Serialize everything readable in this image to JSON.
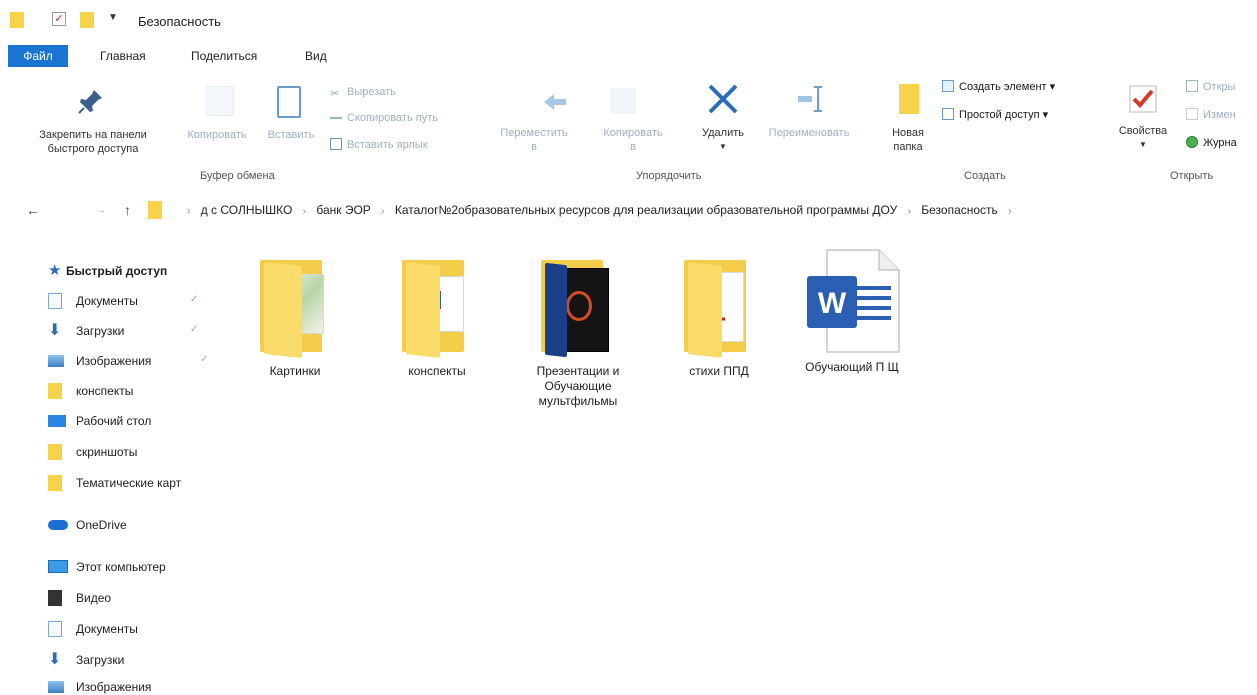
{
  "window": {
    "title": "Безопасность"
  },
  "ribbon_tabs": [
    "Файл",
    "Главная",
    "Поделиться",
    "Вид"
  ],
  "ribbon": {
    "pin_line1": "Закрепить на панели",
    "pin_line2": "быстрого доступа",
    "copy": "Копировать",
    "paste": "Вставить",
    "cut": "Вырезать",
    "copy_path": "Скопировать путь",
    "paste_shortcut": "Вставить ярлык",
    "clipboard_group": "Буфер обмена",
    "move_to_line1": "Переместить",
    "move_to_line2": "в",
    "copy_to_line1": "Копировать",
    "copy_to_line2": "в",
    "delete": "Удалить",
    "rename": "Переименовать",
    "organize_group": "Упорядочить",
    "new_folder_line1": "Новая",
    "new_folder_line2": "папка",
    "new_item": "Создать элемент ▾",
    "easy_access": "Простой доступ ▾",
    "create_group": "Создать",
    "properties": "Свойства",
    "open": "Откры",
    "edit": "Измен",
    "history": "Журна",
    "open_group": "Открыть"
  },
  "address": {
    "crumbs": [
      "д с СОЛНЫШКО",
      "банк ЭОР",
      "Каталог№2образовательных ресурсов для реализации образовательной программы ДОУ",
      "Безопасность"
    ]
  },
  "nav": {
    "quick_access": "Быстрый доступ",
    "items": [
      "Документы",
      "Загрузки",
      "Изображения",
      "конспекты",
      "Рабочий стол",
      "скриншоты",
      "Тематические карт"
    ],
    "onedrive": "OneDrive",
    "this_pc": "Этот компьютер",
    "pc_items": [
      "Видео",
      "Документы",
      "Загрузки",
      "Изображения"
    ]
  },
  "files": [
    {
      "name": "Картинки",
      "type": "folder"
    },
    {
      "name": "конспекты",
      "type": "folder"
    },
    {
      "name": "Презентации и Обучающие мультфильмы",
      "type": "folder"
    },
    {
      "name": "стихи ППД",
      "type": "folder"
    },
    {
      "name": "Обучающий П Щ",
      "type": "word-document"
    }
  ],
  "colors": {
    "accent": "#1a75d2",
    "folder": "#f6d34a",
    "word_blue": "#2b5fb4"
  }
}
